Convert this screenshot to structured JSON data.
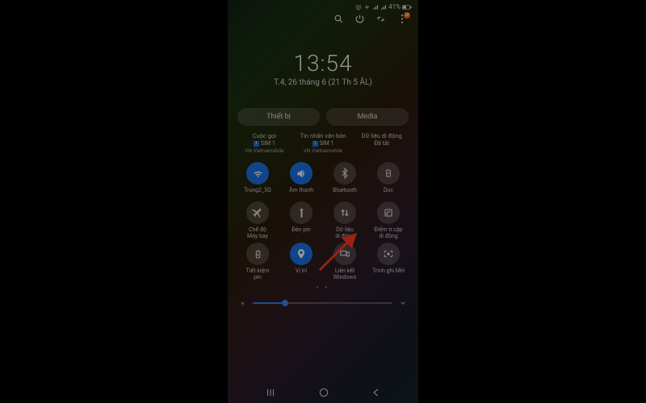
{
  "status": {
    "battery": "41%",
    "alarm_icon": "⏰",
    "wifi_icon": "📶"
  },
  "topactions": {
    "search": "search-icon",
    "power": "power-icon",
    "settings": "gear-icon",
    "more": "more-icon",
    "badge": "M"
  },
  "clock": {
    "time": "13:54",
    "date": "T.4, 26 tháng 6 (21 Th 5 ÂL)"
  },
  "tabs": {
    "a": "Thiết bị",
    "b": "Media"
  },
  "sims": [
    {
      "title": "Cuộc gọi",
      "sub": "SIM 1",
      "carrier": "VN Vietnamobile"
    },
    {
      "title": "Tin nhắn văn bản",
      "sub": "SIM 1",
      "carrier": "VN Vietnamobile"
    },
    {
      "title": "Dữ liệu di động",
      "sub": "Đã tắt",
      "carrier": ""
    }
  ],
  "tiles": [
    {
      "label": "Trung2_5G",
      "on": true,
      "icon": "wifi"
    },
    {
      "label": "Âm thanh",
      "on": true,
      "icon": "sound"
    },
    {
      "label": "Bluetooth",
      "on": false,
      "icon": "bt"
    },
    {
      "label": "Dọc",
      "on": false,
      "icon": "rotate"
    },
    {
      "label": "Chế độ\nMáy bay",
      "on": false,
      "icon": "plane"
    },
    {
      "label": "Đèn pin",
      "on": false,
      "icon": "flash"
    },
    {
      "label": "Dữ liệu\ndi động",
      "on": false,
      "icon": "data"
    },
    {
      "label": "Điểm tr.cập\ndi động",
      "on": false,
      "icon": "hotspot"
    },
    {
      "label": "Tiết kiệm\npin",
      "on": false,
      "icon": "battery"
    },
    {
      "label": "Vị trí",
      "on": true,
      "icon": "location"
    },
    {
      "label": "Liên kết\nWindows",
      "on": false,
      "icon": "link"
    },
    {
      "label": "Trình ghi MH",
      "on": false,
      "icon": "record"
    }
  ],
  "dots": "• •",
  "brightness": {
    "value": 23
  },
  "nav": {
    "recent": "|||",
    "home": "○",
    "back": "‹"
  },
  "arrow": {
    "color": "#ff3b1f"
  }
}
